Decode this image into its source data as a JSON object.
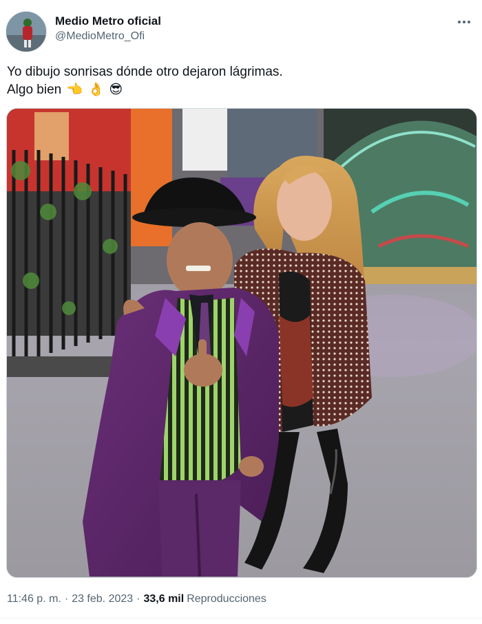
{
  "author": {
    "display_name": "Medio Metro oficial",
    "handle": "@MedioMetro_Ofi"
  },
  "tweet": {
    "line1": "Yo dibujo sonrisas dónde otro dejaron lágrimas.",
    "line2": "Algo bien",
    "emojis": [
      "👈",
      "👌",
      "😎"
    ]
  },
  "meta": {
    "time": "11:46 p. m.",
    "separator": "·",
    "date": "23 feb. 2023",
    "views_count": "33,6 mil",
    "views_label": "Reproducciones"
  },
  "icons": {
    "more": "more-options-icon"
  },
  "colors": {
    "text_primary": "#0f1419",
    "text_secondary": "#536471",
    "border": "#cfd9de"
  }
}
